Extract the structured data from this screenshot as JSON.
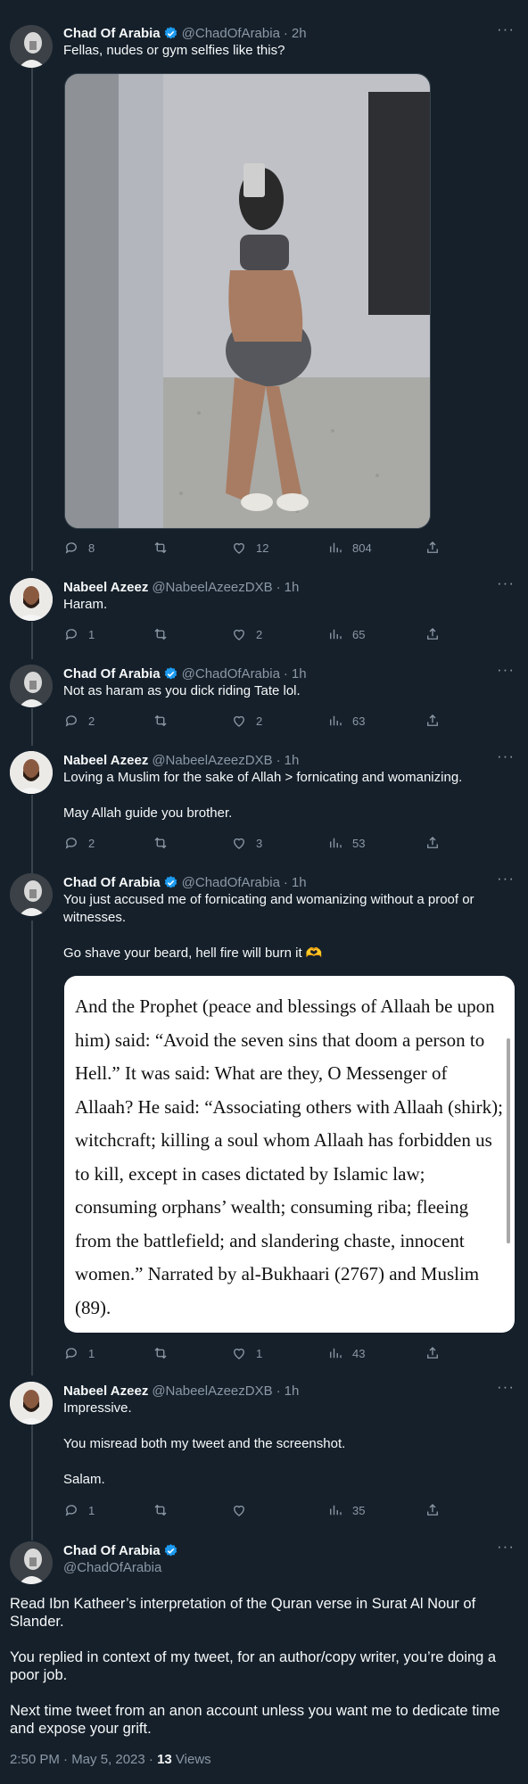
{
  "tweets": [
    {
      "name": "Chad Of Arabia",
      "handle": "@ChadOfArabia",
      "time": "2h",
      "text": "Fellas, nudes or gym selfies like this?",
      "replies": "8",
      "retweets": "",
      "likes": "12",
      "views": "804"
    },
    {
      "name": "Nabeel Azeez",
      "handle": "@NabeelAzeezDXB",
      "time": "1h",
      "text": "Haram.",
      "replies": "1",
      "retweets": "",
      "likes": "2",
      "views": "65"
    },
    {
      "name": "Chad Of Arabia",
      "handle": "@ChadOfArabia",
      "time": "1h",
      "text": "Not as haram as you dick riding Tate lol.",
      "replies": "2",
      "retweets": "",
      "likes": "2",
      "views": "63"
    },
    {
      "name": "Nabeel Azeez",
      "handle": "@NabeelAzeezDXB",
      "time": "1h",
      "text": "Loving a Muslim for the sake of Allah > fornicating and womanizing.\n\nMay Allah guide you brother.",
      "replies": "2",
      "retweets": "",
      "likes": "3",
      "views": "53"
    },
    {
      "name": "Chad Of Arabia",
      "handle": "@ChadOfArabia",
      "time": "1h",
      "text": "You just accused me of fornicating and womanizing without a proof or witnesses.\n\nGo shave your beard, hell fire will burn it 🫶",
      "replies": "1",
      "retweets": "",
      "likes": "1",
      "views": "43"
    },
    {
      "name": "Nabeel Azeez",
      "handle": "@NabeelAzeezDXB",
      "time": "1h",
      "text": "Impressive.\n\nYou misread both my tweet and the screenshot.\n\nSalam.",
      "replies": "1",
      "retweets": "",
      "likes": "",
      "views": "35"
    }
  ],
  "quote_text": "And the Prophet (peace and blessings of Allaah be upon him) said: “Avoid the seven sins that doom a person to Hell.” It was said: What are they, O Messenger of Allaah? He said: “Associating others with Allaah (shirk); witchcraft; killing a soul whom Allaah has forbidden us to kill, except in cases dictated by Islamic law; consuming orphans’ wealth; consuming riba; fleeing from the battlefield; and slandering chaste, innocent women.” Narrated by al-Bukhaari (2767) and Muslim (89).",
  "main": {
    "name": "Chad Of Arabia",
    "handle": "@ChadOfArabia",
    "text": "Read Ibn Katheer’s interpretation of the Quran verse in Surat Al Nour of Slander.\n\nYou replied in context of my tweet, for an author/copy writer, you’re doing a poor job.\n\nNext time tweet from an anon account unless you want me to dedicate time and expose your grift.",
    "time": "2:50 PM · May 5, 2023 · ",
    "views_count": "13",
    "views_label": " Views"
  },
  "colors": {
    "background": "#15202b",
    "text": "#f7f9f9",
    "secondary": "#8b98a5",
    "verified": "#1d9bf0",
    "divider": "#38444d"
  },
  "icons": [
    "reply-icon",
    "retweet-icon",
    "like-icon",
    "views-icon",
    "share-icon",
    "verified-badge-icon",
    "more-icon"
  ]
}
